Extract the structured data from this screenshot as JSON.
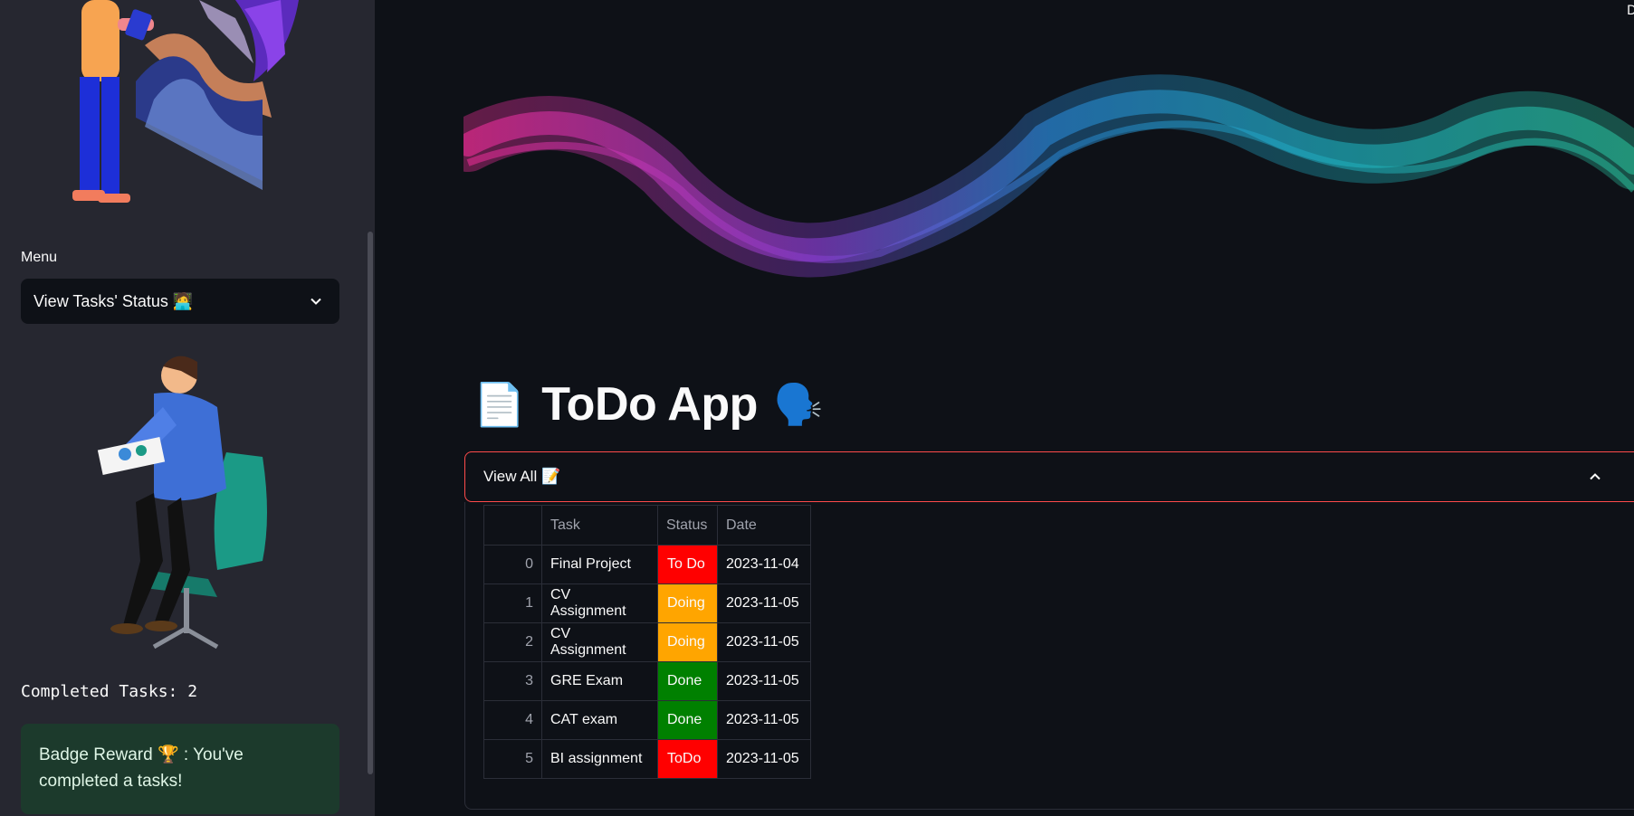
{
  "sidebar": {
    "menu_label": "Menu",
    "menu_selected": "View Tasks' Status 🧑‍💻",
    "completed_text": "Completed Tasks: 2",
    "badge_text": "Badge Reward 🏆 : You've completed a tasks!"
  },
  "main": {
    "title_emoji_left": "📄",
    "title": "ToDo App",
    "title_emoji_right": "🗣️",
    "expander_label": "View All 📝",
    "corner_text": "D"
  },
  "table": {
    "columns": [
      "",
      "Task",
      "Status",
      "Date"
    ],
    "rows": [
      {
        "index": "0",
        "task": "Final Project",
        "status": "To Do",
        "date": "2023-11-04",
        "status_color": "#ff0000"
      },
      {
        "index": "1",
        "task": "CV Assignment",
        "status": "Doing",
        "date": "2023-11-05",
        "status_color": "#ffa500"
      },
      {
        "index": "2",
        "task": "CV Assignment",
        "status": "Doing",
        "date": "2023-11-05",
        "status_color": "#ffa500"
      },
      {
        "index": "3",
        "task": "GRE Exam",
        "status": "Done",
        "date": "2023-11-05",
        "status_color": "#008000"
      },
      {
        "index": "4",
        "task": "CAT exam",
        "status": "Done",
        "date": "2023-11-05",
        "status_color": "#008000"
      },
      {
        "index": "5",
        "task": "BI assignment",
        "status": "ToDo",
        "date": "2023-11-05",
        "status_color": "#ff0000"
      }
    ]
  },
  "colors": {
    "background": "#0e1117",
    "sidebar": "#262730",
    "accent_border": "#ff4b4b",
    "success_bg": "#1c3a2c"
  }
}
